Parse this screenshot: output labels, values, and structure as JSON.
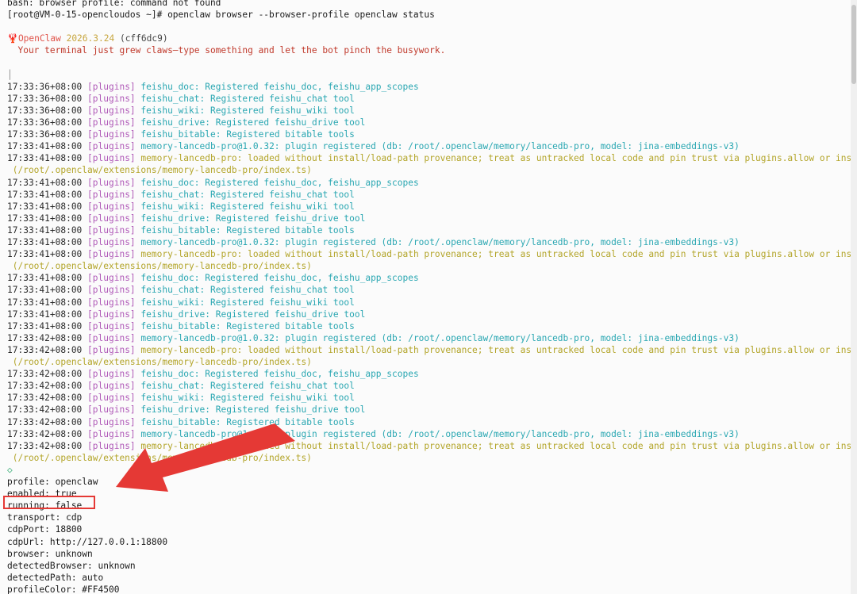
{
  "terminal": {
    "lines": [
      {
        "kind": "plain",
        "text": "bash: browser profile: command not found"
      },
      {
        "kind": "plain",
        "text": "[root@VM-0-15-opencloudos ~]# openclaw browser --browser-profile openclaw status"
      },
      {
        "kind": "blank"
      },
      {
        "kind": "banner",
        "icon": "🦞",
        "brand": "OpenClaw",
        "version": "2026.3.24",
        "hash": "(cff6dc9)"
      },
      {
        "kind": "tagline",
        "text": "  Your terminal just grew claws—type something and let the bot pinch the busywork."
      },
      {
        "kind": "blank"
      },
      {
        "kind": "pipe",
        "text": "│"
      },
      {
        "kind": "log",
        "ts": "17:33:36+08:00",
        "tag": "[plugins]",
        "src": "feishu_doc:",
        "msg": "Registered feishu_doc, feishu_app_scopes",
        "style": "c-msg"
      },
      {
        "kind": "log",
        "ts": "17:33:36+08:00",
        "tag": "[plugins]",
        "src": "feishu_chat:",
        "msg": "Registered feishu_chat tool",
        "style": "c-msg"
      },
      {
        "kind": "log",
        "ts": "17:33:36+08:00",
        "tag": "[plugins]",
        "src": "feishu_wiki:",
        "msg": "Registered feishu_wiki tool",
        "style": "c-msg"
      },
      {
        "kind": "log",
        "ts": "17:33:36+08:00",
        "tag": "[plugins]",
        "src": "feishu_drive:",
        "msg": "Registered feishu_drive tool",
        "style": "c-msg"
      },
      {
        "kind": "log",
        "ts": "17:33:36+08:00",
        "tag": "[plugins]",
        "src": "feishu_bitable:",
        "msg": "Registered bitable tools",
        "style": "c-msg"
      },
      {
        "kind": "log",
        "ts": "17:33:41+08:00",
        "tag": "[plugins]",
        "src": "memory-lancedb-pro@1.0.32:",
        "msg": "plugin registered (db: /root/.openclaw/memory/lancedb-pro, model: jina-embeddings-v3)",
        "style": "c-msg"
      },
      {
        "kind": "log",
        "ts": "17:33:41+08:00",
        "tag": "[plugins]",
        "src": "memory-lancedb-pro:",
        "msg": "loaded without install/load-path provenance; treat as untracked local code and pin trust via plugins.allow or install records",
        "style": "c-warn"
      },
      {
        "kind": "cont",
        "text": " (/root/.openclaw/extensions/memory-lancedb-pro/index.ts)"
      },
      {
        "kind": "log",
        "ts": "17:33:41+08:00",
        "tag": "[plugins]",
        "src": "feishu_doc:",
        "msg": "Registered feishu_doc, feishu_app_scopes",
        "style": "c-msg"
      },
      {
        "kind": "log",
        "ts": "17:33:41+08:00",
        "tag": "[plugins]",
        "src": "feishu_chat:",
        "msg": "Registered feishu_chat tool",
        "style": "c-msg"
      },
      {
        "kind": "log",
        "ts": "17:33:41+08:00",
        "tag": "[plugins]",
        "src": "feishu_wiki:",
        "msg": "Registered feishu_wiki tool",
        "style": "c-msg"
      },
      {
        "kind": "log",
        "ts": "17:33:41+08:00",
        "tag": "[plugins]",
        "src": "feishu_drive:",
        "msg": "Registered feishu_drive tool",
        "style": "c-msg"
      },
      {
        "kind": "log",
        "ts": "17:33:41+08:00",
        "tag": "[plugins]",
        "src": "feishu_bitable:",
        "msg": "Registered bitable tools",
        "style": "c-msg"
      },
      {
        "kind": "log",
        "ts": "17:33:41+08:00",
        "tag": "[plugins]",
        "src": "memory-lancedb-pro@1.0.32:",
        "msg": "plugin registered (db: /root/.openclaw/memory/lancedb-pro, model: jina-embeddings-v3)",
        "style": "c-msg"
      },
      {
        "kind": "log",
        "ts": "17:33:41+08:00",
        "tag": "[plugins]",
        "src": "memory-lancedb-pro:",
        "msg": "loaded without install/load-path provenance; treat as untracked local code and pin trust via plugins.allow or install records",
        "style": "c-warn"
      },
      {
        "kind": "cont",
        "text": " (/root/.openclaw/extensions/memory-lancedb-pro/index.ts)"
      },
      {
        "kind": "log",
        "ts": "17:33:41+08:00",
        "tag": "[plugins]",
        "src": "feishu_doc:",
        "msg": "Registered feishu_doc, feishu_app_scopes",
        "style": "c-msg"
      },
      {
        "kind": "log",
        "ts": "17:33:41+08:00",
        "tag": "[plugins]",
        "src": "feishu_chat:",
        "msg": "Registered feishu_chat tool",
        "style": "c-msg"
      },
      {
        "kind": "log",
        "ts": "17:33:41+08:00",
        "tag": "[plugins]",
        "src": "feishu_wiki:",
        "msg": "Registered feishu_wiki tool",
        "style": "c-msg"
      },
      {
        "kind": "log",
        "ts": "17:33:41+08:00",
        "tag": "[plugins]",
        "src": "feishu_drive:",
        "msg": "Registered feishu_drive tool",
        "style": "c-msg"
      },
      {
        "kind": "log",
        "ts": "17:33:41+08:00",
        "tag": "[plugins]",
        "src": "feishu_bitable:",
        "msg": "Registered bitable tools",
        "style": "c-msg"
      },
      {
        "kind": "log",
        "ts": "17:33:42+08:00",
        "tag": "[plugins]",
        "src": "memory-lancedb-pro@1.0.32:",
        "msg": "plugin registered (db: /root/.openclaw/memory/lancedb-pro, model: jina-embeddings-v3)",
        "style": "c-msg"
      },
      {
        "kind": "log",
        "ts": "17:33:42+08:00",
        "tag": "[plugins]",
        "src": "memory-lancedb-pro:",
        "msg": "loaded without install/load-path provenance; treat as untracked local code and pin trust via plugins.allow or install records",
        "style": "c-warn"
      },
      {
        "kind": "cont",
        "text": " (/root/.openclaw/extensions/memory-lancedb-pro/index.ts)"
      },
      {
        "kind": "log",
        "ts": "17:33:42+08:00",
        "tag": "[plugins]",
        "src": "feishu_doc:",
        "msg": "Registered feishu_doc, feishu_app_scopes",
        "style": "c-msg"
      },
      {
        "kind": "log",
        "ts": "17:33:42+08:00",
        "tag": "[plugins]",
        "src": "feishu_chat:",
        "msg": "Registered feishu_chat tool",
        "style": "c-msg"
      },
      {
        "kind": "log",
        "ts": "17:33:42+08:00",
        "tag": "[plugins]",
        "src": "feishu_wiki:",
        "msg": "Registered feishu_wiki tool",
        "style": "c-msg"
      },
      {
        "kind": "log",
        "ts": "17:33:42+08:00",
        "tag": "[plugins]",
        "src": "feishu_drive:",
        "msg": "Registered feishu_drive tool",
        "style": "c-msg"
      },
      {
        "kind": "log",
        "ts": "17:33:42+08:00",
        "tag": "[plugins]",
        "src": "feishu_bitable:",
        "msg": "Registered bitable tools",
        "style": "c-msg"
      },
      {
        "kind": "log",
        "ts": "17:33:42+08:00",
        "tag": "[plugins]",
        "src": "memory-lancedb-pro@1.0.32:",
        "msg": "plugin registered (db: /root/.openclaw/memory/lancedb-pro, model: jina-embeddings-v3)",
        "style": "c-msg"
      },
      {
        "kind": "log",
        "ts": "17:33:42+08:00",
        "tag": "[plugins]",
        "src": "memory-lancedb-pro:",
        "msg": "loaded without install/load-path provenance; treat as untracked local code and pin trust via plugins.allow or install records",
        "style": "c-warn"
      },
      {
        "kind": "cont",
        "text": " (/root/.openclaw/extensions/memory-lancedb-pro/index.ts)"
      },
      {
        "kind": "diamond",
        "text": "◇"
      },
      {
        "kind": "plain",
        "text": "profile: openclaw"
      },
      {
        "kind": "plain",
        "text": "enabled: true"
      },
      {
        "kind": "plain",
        "text": "running: false"
      },
      {
        "kind": "plain",
        "text": "transport: cdp"
      },
      {
        "kind": "plain",
        "text": "cdpPort: 18800"
      },
      {
        "kind": "plain",
        "text": "cdpUrl: http://127.0.0.1:18800"
      },
      {
        "kind": "plain",
        "text": "browser: unknown"
      },
      {
        "kind": "plain",
        "text": "detectedBrowser: unknown"
      },
      {
        "kind": "plain",
        "text": "detectedPath: auto"
      },
      {
        "kind": "plain",
        "text": "profileColor: #FF4500"
      }
    ]
  },
  "annotation": {
    "color": "#e53935"
  }
}
